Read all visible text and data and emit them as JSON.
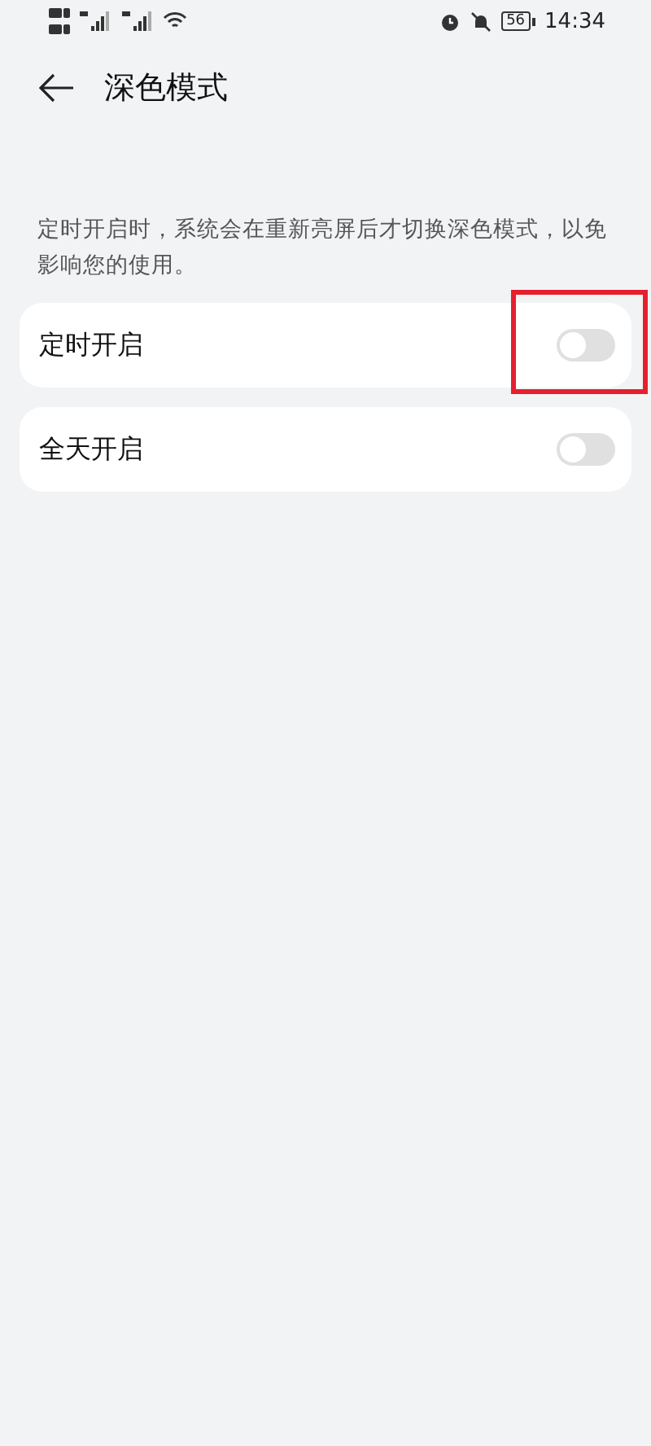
{
  "status_bar": {
    "battery": "56",
    "time": "14:34"
  },
  "header": {
    "title": "深色模式"
  },
  "description": "定时开启时，系统会在重新亮屏后才切换深色模式，以免影响您的使用。",
  "settings": [
    {
      "label": "定时开启",
      "on": false,
      "highlighted": true
    },
    {
      "label": "全天开启",
      "on": false,
      "highlighted": false
    }
  ]
}
